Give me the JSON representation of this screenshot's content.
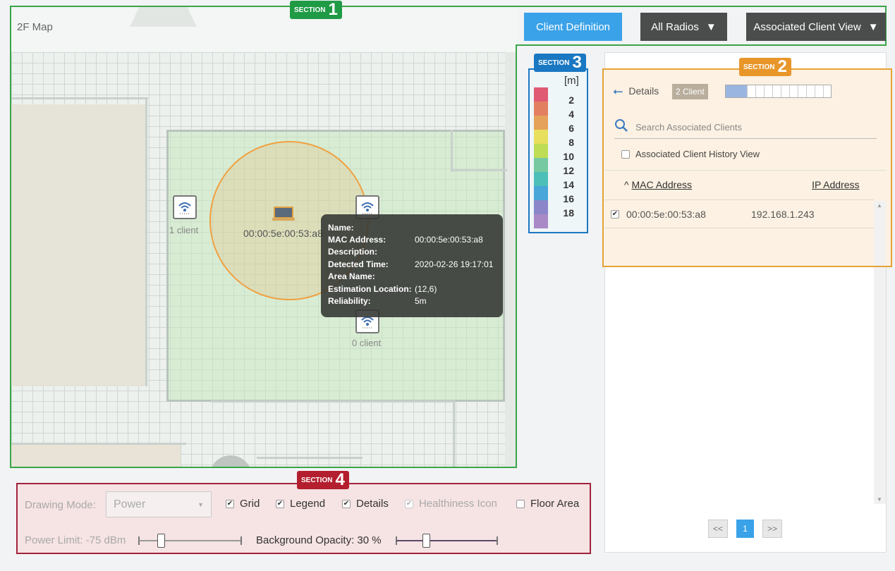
{
  "map": {
    "title": "2F Map",
    "ap_left_label": "1 client",
    "ap_bottom_label": "0 client",
    "client_mac_label": "00:00:5e:00:53:a8"
  },
  "toolbar": {
    "client_definition": "Client Definition",
    "all_radios": "All Radios",
    "view": "Associated Client View"
  },
  "sections": {
    "s1": "1",
    "s2": "2",
    "s3": "3",
    "s4": "4",
    "word": "SECTION"
  },
  "tooltip": {
    "rows": [
      {
        "k": "Name:",
        "v": ""
      },
      {
        "k": "MAC Address:",
        "v": "00:00:5e:00:53:a8"
      },
      {
        "k": "Description:",
        "v": ""
      },
      {
        "k": "Detected Time:",
        "v": "2020-02-26 19:17:01"
      },
      {
        "k": "Area Name:",
        "v": ""
      },
      {
        "k": "Estimation Location:",
        "v": "(12,6)"
      },
      {
        "k": "Reliability:",
        "v": "5m"
      }
    ]
  },
  "legend": {
    "unit": "[m]",
    "values": [
      "2",
      "4",
      "6",
      "8",
      "10",
      "12",
      "14",
      "16",
      "18"
    ],
    "colors": [
      "#e05a73",
      "#e37f61",
      "#e5a25a",
      "#e8df5c",
      "#bedd55",
      "#76c9a0",
      "#4bbfb8",
      "#48a6d8",
      "#8a86c9",
      "#a98ac6"
    ]
  },
  "panel": {
    "details": "Details",
    "badge": "2 Client",
    "search_placeholder": "Search Associated Clients",
    "history_label": "Associated Client History View",
    "col_mac": "MAC Address",
    "col_ip": "IP Address",
    "rows": [
      {
        "mac": "00:00:5e:00:53:a8",
        "ip": "192.168.1.243",
        "checked": true
      }
    ],
    "pager_prev": "<<",
    "pager_page": "1",
    "pager_next": ">>"
  },
  "controls": {
    "drawing_mode_label": "Drawing Mode:",
    "drawing_mode_value": "Power",
    "grid": "Grid",
    "legend": "Legend",
    "details": "Details",
    "healthiness": "Healthiness Icon",
    "floor_area": "Floor Area",
    "power_limit": "Power Limit: -75 dBm",
    "bg_opacity": "Background Opacity: 30 %"
  }
}
